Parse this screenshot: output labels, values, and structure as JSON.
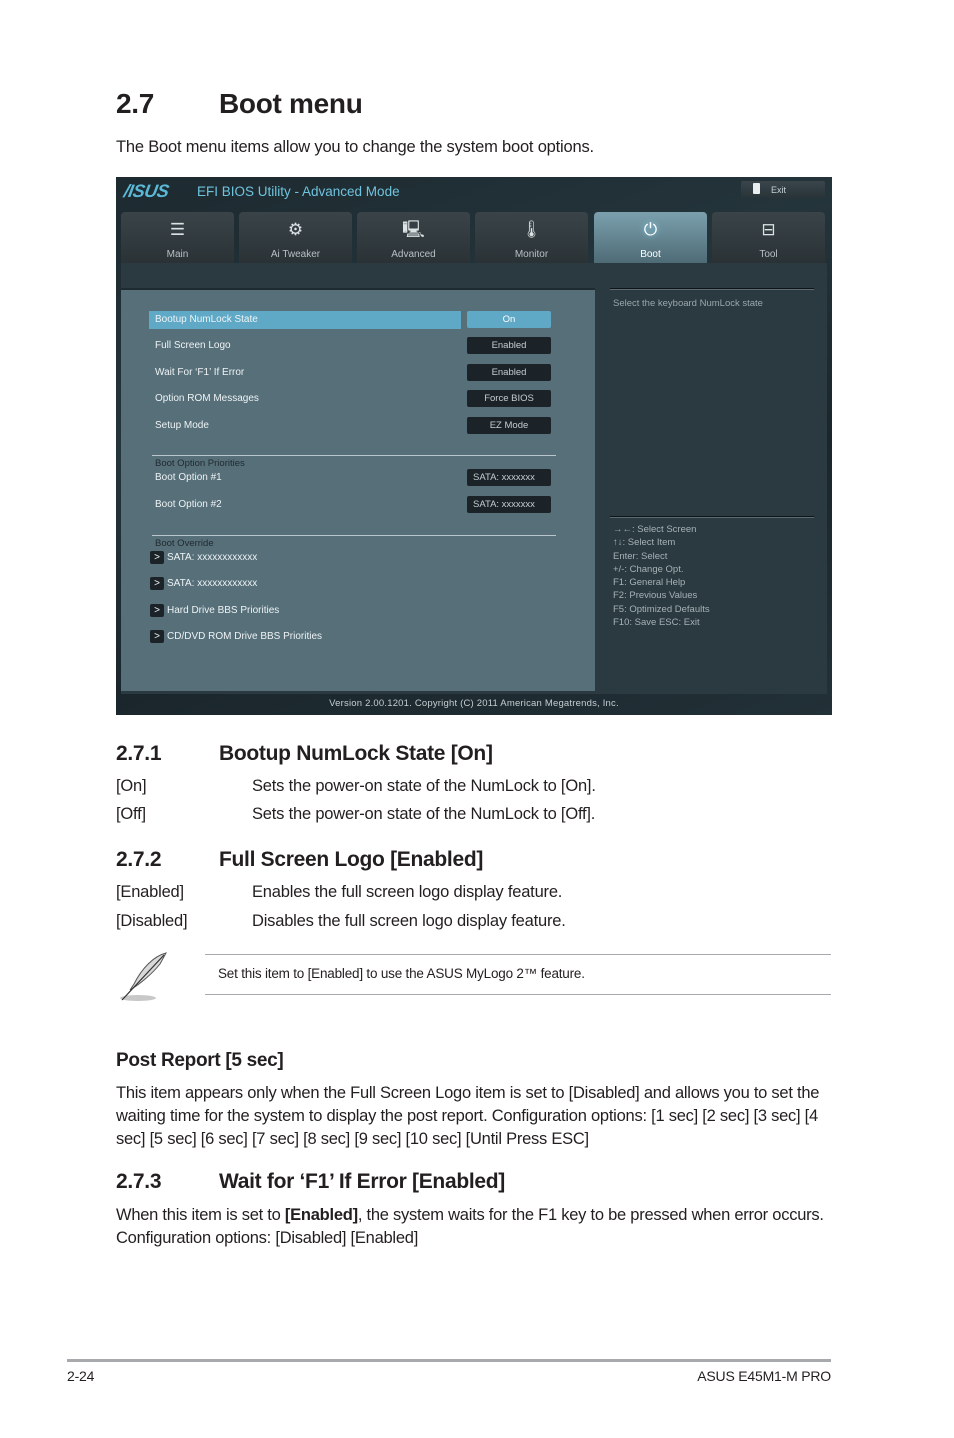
{
  "section": {
    "number": "2.7",
    "title": "Boot menu",
    "intro": "The Boot menu items allow you to change the system boot options."
  },
  "bios": {
    "brand": "/ISUS",
    "title": "EFI BIOS Utility - Advanced Mode",
    "exit_label": "Exit",
    "tabs": [
      {
        "label": "Main",
        "icon": "list-icon",
        "glyph": "☰"
      },
      {
        "label": "Ai  Tweaker",
        "icon": "tweaker-icon",
        "glyph": "⚙"
      },
      {
        "label": "Advanced",
        "icon": "advanced-icon",
        "glyph": "🖳"
      },
      {
        "label": "Monitor",
        "icon": "monitor-icon",
        "glyph": "🌡"
      },
      {
        "label": "Boot",
        "icon": "power-icon",
        "glyph": "⏻"
      },
      {
        "label": "Tool",
        "icon": "toolbox-icon",
        "glyph": "⊟"
      }
    ],
    "active_tab": "Boot",
    "settings": [
      {
        "label": "Bootup NumLock State",
        "value": "On",
        "selected": true
      },
      {
        "label": "Full Screen Logo",
        "value": "Enabled"
      },
      {
        "label": "Wait For ‘F1’ If Error",
        "value": "Enabled"
      },
      {
        "label": "Option ROM Messages",
        "value": "Force BIOS"
      },
      {
        "label": "Setup Mode",
        "value": "EZ Mode"
      }
    ],
    "boot_priorities": {
      "title": "Boot Option Priorities",
      "options": [
        {
          "label": "Boot Option #1",
          "value": "SATA: xxxxxxx"
        },
        {
          "label": "Boot Option #2",
          "value": "SATA: xxxxxxx"
        }
      ]
    },
    "boot_override": {
      "title": "Boot Override",
      "arrow": ">",
      "items": [
        "SATA: xxxxxxxxxxxx",
        "SATA: xxxxxxxxxxxx",
        "Hard Drive BBS Priorities",
        "CD/DVD ROM Drive BBS Priorities"
      ]
    },
    "help_text": "Select the keyboard NumLock state",
    "key_legend": [
      "→←:  Select Screen",
      "↑↓:  Select Item",
      "Enter:  Select",
      "+/-:  Change Opt.",
      "F1:  General Help",
      "F2:  Previous Values",
      "F5:  Optimized Defaults",
      "F10:  Save    ESC:  Exit"
    ],
    "version": "Version  2.00.1201.  Copyright  (C)  2011  American  Megatrends,  Inc."
  },
  "sub_2_7_1": {
    "number": "2.7.1",
    "title": "Bootup NumLock State [On]",
    "options": [
      {
        "key": "[On]",
        "desc": "Sets the power-on state of the NumLock to [On]."
      },
      {
        "key": "[Off]",
        "desc": "Sets the power-on state of the NumLock to [Off]."
      }
    ]
  },
  "sub_2_7_2": {
    "number": "2.7.2",
    "title": "Full Screen Logo [Enabled]",
    "options": [
      {
        "key": "[Enabled]",
        "desc": "Enables the full screen logo display feature."
      },
      {
        "key": "[Disabled]",
        "desc": "Disables the full screen logo display feature."
      }
    ],
    "note": "Set this item to [Enabled] to use the ASUS MyLogo 2™ feature."
  },
  "post_report": {
    "title": "Post Report [5 sec]",
    "body": "This item appears only when the Full Screen Logo item is set to [Disabled] and allows you to set the waiting time for the system to display the post report. Configuration options: [1 sec] [2 sec] [3 sec] [4 sec] [5 sec] [6 sec] [7 sec] [8 sec] [9 sec] [10 sec] [Until Press ESC]"
  },
  "sub_2_7_3": {
    "number": "2.7.3",
    "title": "Wait for ‘F1’ If Error [Enabled]",
    "body_prefix": "When this item is set to ",
    "body_bold": "[Enabled]",
    "body_suffix": ", the system waits for the F1 key to be pressed when error occurs. Configuration options: [Disabled] [Enabled]"
  },
  "footer": {
    "page": "2-24",
    "product": "ASUS E45M1-M PRO"
  }
}
